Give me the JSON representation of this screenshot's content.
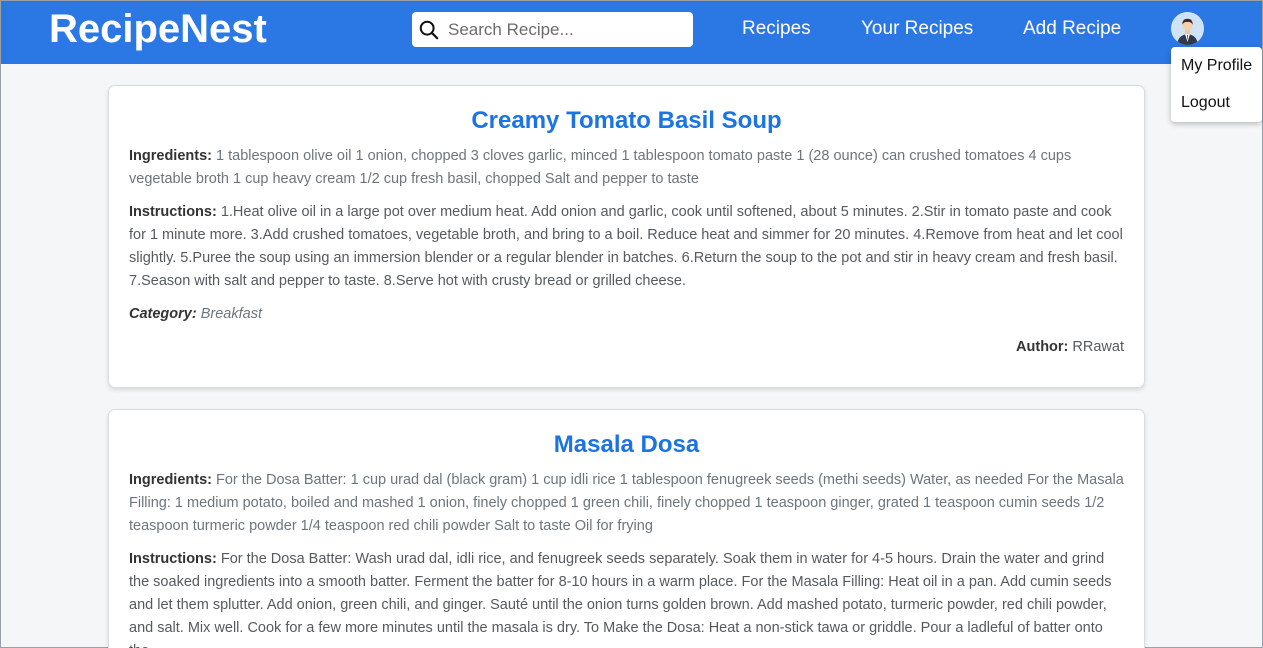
{
  "app": {
    "brand": "RecipeNest"
  },
  "search": {
    "placeholder": "Search Recipe...",
    "value": ""
  },
  "nav": {
    "links": [
      "Recipes",
      "Your Recipes",
      "Add Recipe"
    ]
  },
  "profile_menu": {
    "items": [
      "My Profile",
      "Logout"
    ]
  },
  "labels": {
    "ingredients": "Ingredients:",
    "instructions": "Instructions:",
    "category": "Category:",
    "author": "Author:"
  },
  "recipes": [
    {
      "title": "Creamy Tomato Basil Soup",
      "ingredients": "1 tablespoon olive oil 1 onion, chopped 3 cloves garlic, minced 1 tablespoon tomato paste 1 (28 ounce) can crushed tomatoes 4 cups vegetable broth 1 cup heavy cream 1/2 cup fresh basil, chopped Salt and pepper to taste",
      "instructions": "1.Heat olive oil in a large pot over medium heat. Add onion and garlic, cook until softened, about 5 minutes. 2.Stir in tomato paste and cook for 1 minute more. 3.Add crushed tomatoes, vegetable broth, and bring to a boil. Reduce heat and simmer for 20 minutes. 4.Remove from heat and let cool slightly. 5.Puree the soup using an immersion blender or a regular blender in batches. 6.Return the soup to the pot and stir in heavy cream and fresh basil. 7.Season with salt and pepper to taste. 8.Serve hot with crusty bread or grilled cheese.",
      "category": "Breakfast",
      "author": "RRawat"
    },
    {
      "title": "Masala Dosa",
      "ingredients": "For the Dosa Batter: 1 cup urad dal (black gram) 1 cup idli rice 1 tablespoon fenugreek seeds (methi seeds) Water, as needed For the Masala Filling: 1 medium potato, boiled and mashed 1 onion, finely chopped 1 green chili, finely chopped 1 teaspoon ginger, grated 1 teaspoon cumin seeds 1/2 teaspoon turmeric powder 1/4 teaspoon red chili powder Salt to taste Oil for frying",
      "instructions": "For the Dosa Batter: Wash urad dal, idli rice, and fenugreek seeds separately. Soak them in water for 4-5 hours. Drain the water and grind the soaked ingredients into a smooth batter. Ferment the batter for 8-10 hours in a warm place. For the Masala Filling: Heat oil in a pan. Add cumin seeds and let them splutter. Add onion, green chili, and ginger. Sauté until the onion turns golden brown. Add mashed potato, turmeric powder, red chili powder, and salt. Mix well. Cook for a few more minutes until the masala is dry. To Make the Dosa: Heat a non-stick tawa or griddle. Pour a ladleful of batter onto the"
    }
  ]
}
